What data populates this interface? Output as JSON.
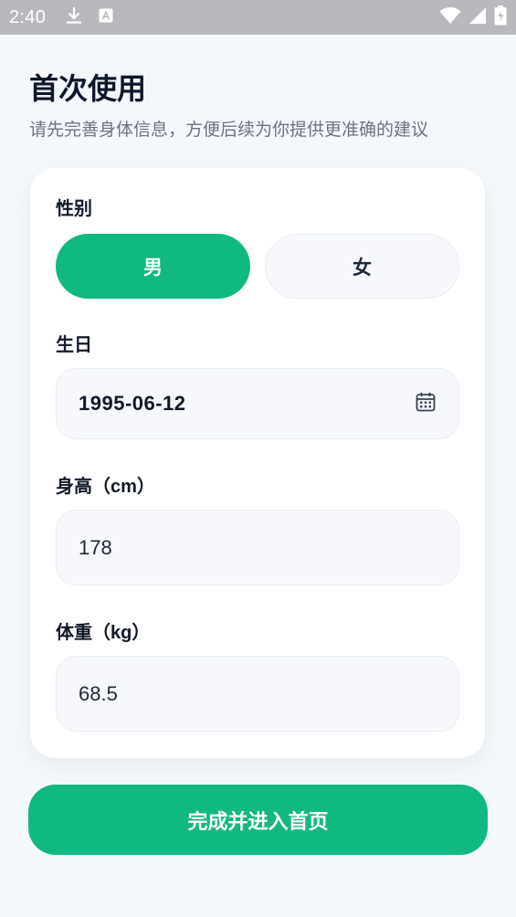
{
  "status_bar": {
    "time": "2:40",
    "icons": [
      "download-icon",
      "keyboard-a-icon",
      "wifi-icon",
      "signal-icon",
      "battery-icon"
    ]
  },
  "header": {
    "title": "首次使用",
    "subtitle": "请先完善身体信息，方便后续为你提供更准确的建议"
  },
  "form": {
    "gender": {
      "label": "性别",
      "options": [
        "男",
        "女"
      ],
      "selected": "男"
    },
    "birthday": {
      "label": "生日",
      "value": "1995-06-12"
    },
    "height": {
      "label": "身高（cm）",
      "value": "178"
    },
    "weight": {
      "label": "体重（kg）",
      "value": "68.5"
    }
  },
  "submit": {
    "label": "完成并进入首页"
  },
  "colors": {
    "accent": "#10b981",
    "status_bar": "#b7b9bc",
    "background": "#f5f8fb"
  }
}
